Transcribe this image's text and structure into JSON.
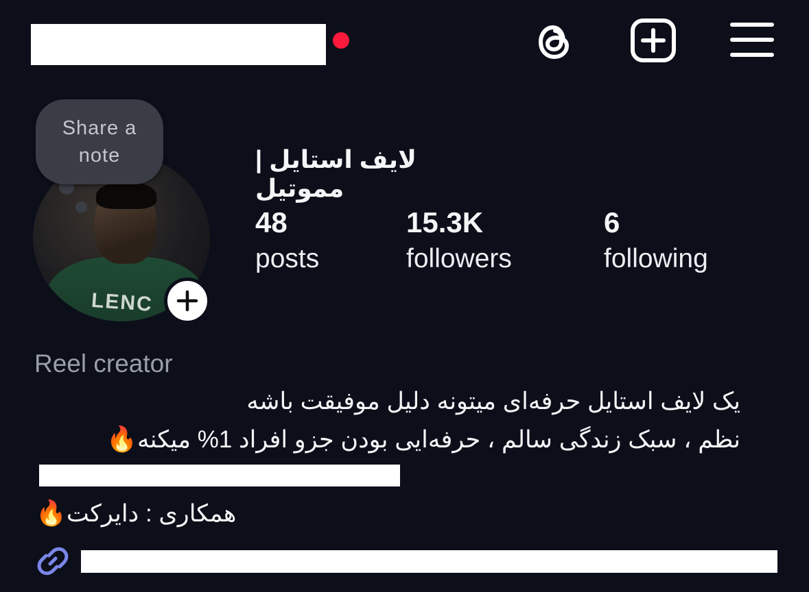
{
  "header": {
    "username_redacted": true,
    "icons": [
      "threads-icon",
      "create-post-icon",
      "menu-icon"
    ]
  },
  "profile": {
    "note_text": "Share a note",
    "display_name": "لایف استایل | مموتیل",
    "stats": [
      {
        "value": "48",
        "label": "posts"
      },
      {
        "value": "15.3K",
        "label": "followers"
      },
      {
        "value": "6",
        "label": "following"
      }
    ]
  },
  "bio": {
    "category": "Reel creator",
    "line1": "یک لایف استایل حرفه‌ای میتونه دلیل موفیقت باشه",
    "line2": "نظم ، سبک زندگی سالم ، حرفه‌ایی بودن جزو افراد 1% میکنه",
    "line2_emoji": "🔥",
    "line4": "همکاری : دایرکت",
    "line4_emoji": "🔥"
  },
  "colors": {
    "background": "#0c0f1a",
    "notification_dot": "#ff1a3d",
    "link": "#7b86e8",
    "secondary_text": "#9a9ea8"
  }
}
